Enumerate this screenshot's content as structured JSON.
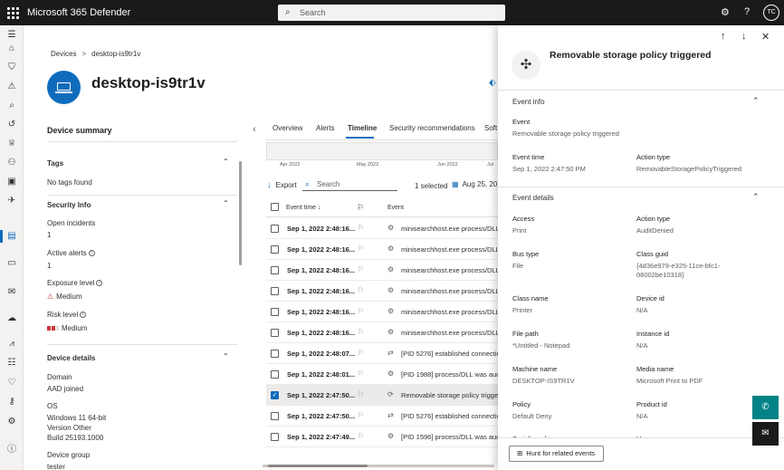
{
  "app": {
    "title": "Microsoft 365 Defender",
    "search_placeholder": "Search",
    "user_initials": "TC"
  },
  "header_icons": [
    "waffle-icon",
    "gear-icon",
    "help-icon"
  ],
  "breadcrumb": {
    "root": "Devices",
    "separator": ">",
    "current": "desktop-is9tr1v"
  },
  "device": {
    "name": "desktop-is9tr1v"
  },
  "summary": {
    "title": "Device summary",
    "tags": {
      "title": "Tags",
      "value": "No tags found"
    },
    "security_info": {
      "title": "Security Info",
      "open_incidents_label": "Open incidents",
      "open_incidents": "1",
      "active_alerts_label": "Active alerts",
      "active_alerts": "1",
      "exposure_label": "Exposure level",
      "exposure_value": "Medium",
      "risk_label": "Risk level",
      "risk_value": "Medium"
    },
    "device_details": {
      "title": "Device details",
      "domain_label": "Domain",
      "domain_value": "AAD joined",
      "os_label": "OS",
      "os_line1": "Windows 11 64-bit",
      "os_line2": "Version Other",
      "os_line3": "Build 25193.1000",
      "group_label": "Device group",
      "group_value": "tester"
    }
  },
  "timeline": {
    "tabs": [
      "Overview",
      "Alerts",
      "Timeline",
      "Security recommendations",
      "Soft"
    ],
    "active_tab": "Timeline",
    "months": [
      "Apr 2022",
      "May 2022",
      "Jun 2022",
      "Jul"
    ],
    "export_label": "Export",
    "search_placeholder": "Search",
    "selected_count": "1 selected",
    "date_filter": "Aug 25, 20",
    "col_event_time": "Event time ↓",
    "col_event": "Event",
    "rows": [
      {
        "time": "Sep 1, 2022 2:48:16...",
        "icon": "⚙",
        "desc": "minisearchhost.exe process/DLL",
        "selected": false
      },
      {
        "time": "Sep 1, 2022 2:48:16...",
        "icon": "⚙",
        "desc": "minisearchhost.exe process/DLL",
        "selected": false
      },
      {
        "time": "Sep 1, 2022 2:48:16...",
        "icon": "⚙",
        "desc": "minisearchhost.exe process/DLL",
        "selected": false
      },
      {
        "time": "Sep 1, 2022 2:48:16...",
        "icon": "⚙",
        "desc": "minisearchhost.exe process/DLL",
        "selected": false
      },
      {
        "time": "Sep 1, 2022 2:48:16...",
        "icon": "⚙",
        "desc": "minisearchhost.exe process/DLL",
        "selected": false
      },
      {
        "time": "Sep 1, 2022 2:48:16...",
        "icon": "⚙",
        "desc": "minisearchhost.exe process/DLL",
        "selected": false
      },
      {
        "time": "Sep 1, 2022 2:48:07...",
        "icon": "⇄",
        "desc": "[PID 5276] established connectio",
        "selected": false
      },
      {
        "time": "Sep 1, 2022 2:48:01...",
        "icon": "⚙",
        "desc": "[PID 1988] process/DLL was aud",
        "selected": false
      },
      {
        "time": "Sep 1, 2022 2:47:50...",
        "icon": "⟳",
        "desc": "Removable storage policy trigge",
        "selected": true
      },
      {
        "time": "Sep 1, 2022 2:47:50...",
        "icon": "⇄",
        "desc": "[PID 5276] established connectio",
        "selected": false
      },
      {
        "time": "Sep 1, 2022 2:47:49...",
        "icon": "⚙",
        "desc": "[PID 1596] process/DLL was aud",
        "selected": false
      }
    ]
  },
  "panel": {
    "title": "Removable storage policy triggered",
    "event_info": {
      "section": "Event info",
      "event_label": "Event",
      "event_value": "Removable storage policy triggered",
      "time_label": "Event time",
      "time_value": "Sep 1, 2022 2:47:50 PM",
      "action_label": "Action type",
      "action_value": "RemovableStoragePolicyTriggered"
    },
    "event_details": {
      "section": "Event details",
      "access_label": "Access",
      "access_value": "Print",
      "action_type_label": "Action type",
      "action_type_value": "AuditDenied",
      "bus_label": "Bus type",
      "bus_value": "File",
      "class_guid_label": "Class guid",
      "class_guid_line1": "{4d36e979-e325-11ce-bfc1-",
      "class_guid_line2": "08002be10318}",
      "class_name_label": "Class name",
      "class_name_value": "Printer",
      "device_id_label": "Device id",
      "device_id_value": "N/A",
      "file_path_label": "File path",
      "file_path_value": "*Untitled - Notepad",
      "instance_label": "Instance id",
      "instance_value": "N/A",
      "machine_label": "Machine name",
      "machine_value": "DESKTOP-IS9TR1V",
      "media_label": "Media name",
      "media_value": "Microsoft Print to PDF",
      "policy_label": "Policy",
      "policy_value": "Default Deny",
      "product_label": "Product id",
      "product_value": "N/A",
      "serial_label": "Serial number",
      "user_label": "User name"
    },
    "hunt_button": "Hunt for related events"
  },
  "colors": {
    "accent": "#0f6cbd",
    "topbar": "#1b1a19",
    "fab": "#038387",
    "danger": "#d13438"
  }
}
